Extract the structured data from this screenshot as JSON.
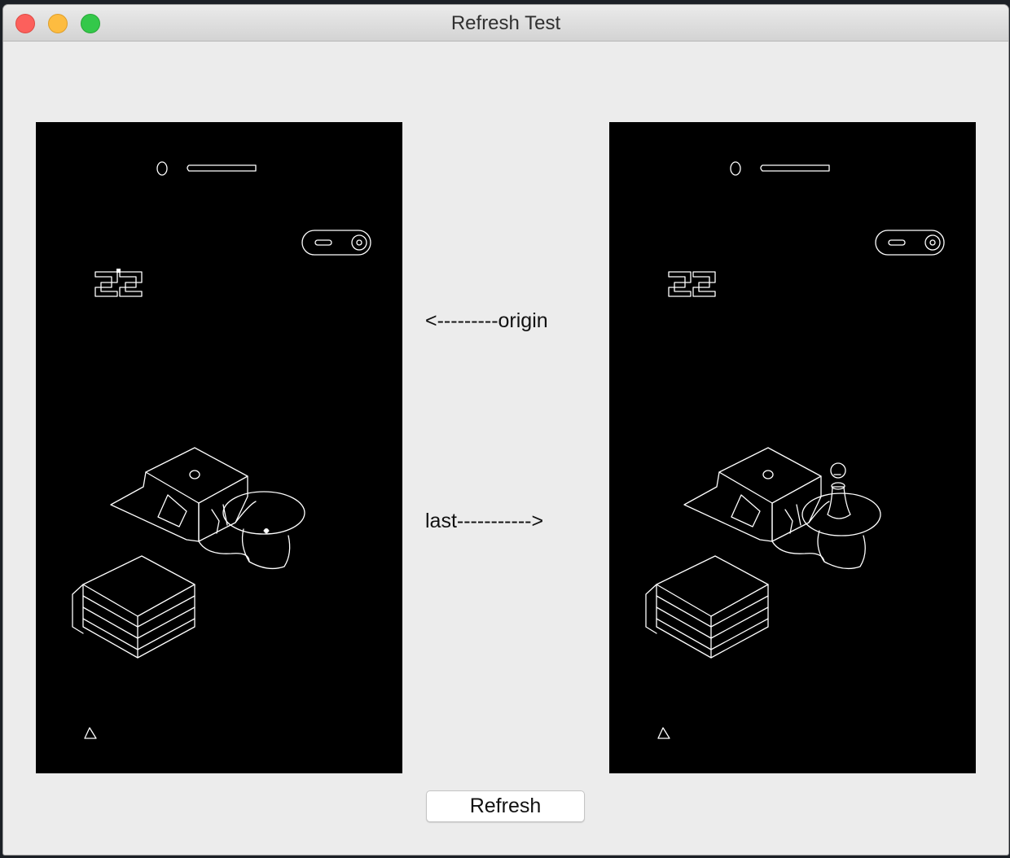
{
  "window": {
    "title": "Refresh Test"
  },
  "title_bar_buttons": [
    "close",
    "minimize",
    "zoom"
  ],
  "labels": {
    "origin": "<---------origin",
    "last": "last----------->"
  },
  "refresh_button": {
    "label": "Refresh"
  },
  "images": [
    {
      "name": "origin-image",
      "hud_number": "22",
      "has_player_piece": false
    },
    {
      "name": "last-image",
      "hud_number": "22",
      "has_player_piece": true
    }
  ]
}
